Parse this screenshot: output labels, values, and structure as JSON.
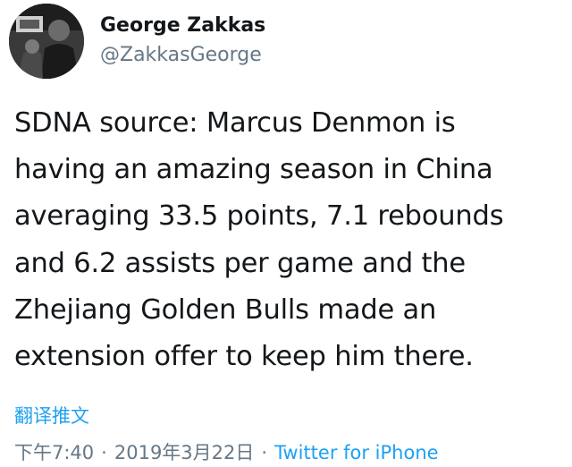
{
  "user": {
    "display_name": "George Zakkas",
    "handle": "@ZakkasGeorge"
  },
  "tweet": {
    "lines": [
      "SDNA source: Marcus Denmon is",
      "having an amazing season in China",
      "averaging 33.5 points, 7.1 rebounds",
      "and 6.2 assists per game and the",
      "Zhejiang Golden Bulls made an",
      "extension offer to keep him there."
    ],
    "translate_label": "翻译推文",
    "time": "下午7:40",
    "separator": "·",
    "date": "2019年3月22日",
    "source": "Twitter for iPhone"
  },
  "colors": {
    "link": "#1da1f2",
    "secondary": "#657786",
    "text": "#14171a"
  }
}
